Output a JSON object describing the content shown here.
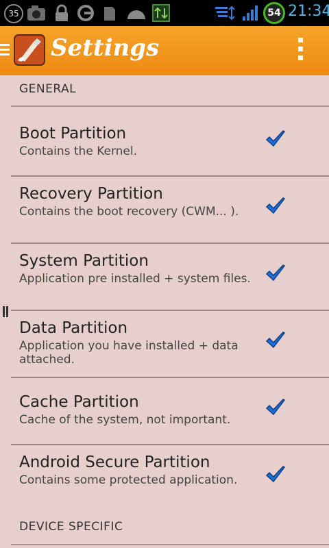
{
  "status_bar": {
    "notification_count": "35",
    "battery_level": "54",
    "clock": "21:34",
    "icons": [
      "camera-icon",
      "lock-icon",
      "sync-icon",
      "sd-card-icon",
      "dome-icon",
      "data-transfer-icon",
      "wifi-icon",
      "signal-icon"
    ]
  },
  "action_bar": {
    "title": "Settings",
    "icons": [
      "menu-icon",
      "app-paint-icon",
      "overflow-menu-icon"
    ]
  },
  "sections": {
    "general": "GENERAL",
    "device_specific": "DEVICE SPECIFIC"
  },
  "items": [
    {
      "title": "Boot Partition",
      "subtitle": "Contains the Kernel.",
      "checked": true
    },
    {
      "title": "Recovery Partition",
      "subtitle": "Contains the boot recovery (CWM... ).",
      "checked": true
    },
    {
      "title": "System Partition",
      "subtitle": "Application pre installed + system files.",
      "checked": true
    },
    {
      "title": "Data Partition",
      "subtitle": "Application you have installed + data attached.",
      "checked": true
    },
    {
      "title": "Cache Partition",
      "subtitle": "Cache of the system, not important.",
      "checked": true
    },
    {
      "title": "Android Secure Partition",
      "subtitle": "Contains some protected application.",
      "checked": true
    }
  ],
  "colors": {
    "action_bar": "#ee8a12",
    "background": "#e6cfcc",
    "check": "#1d6fd8",
    "clock": "#55b8e8"
  }
}
